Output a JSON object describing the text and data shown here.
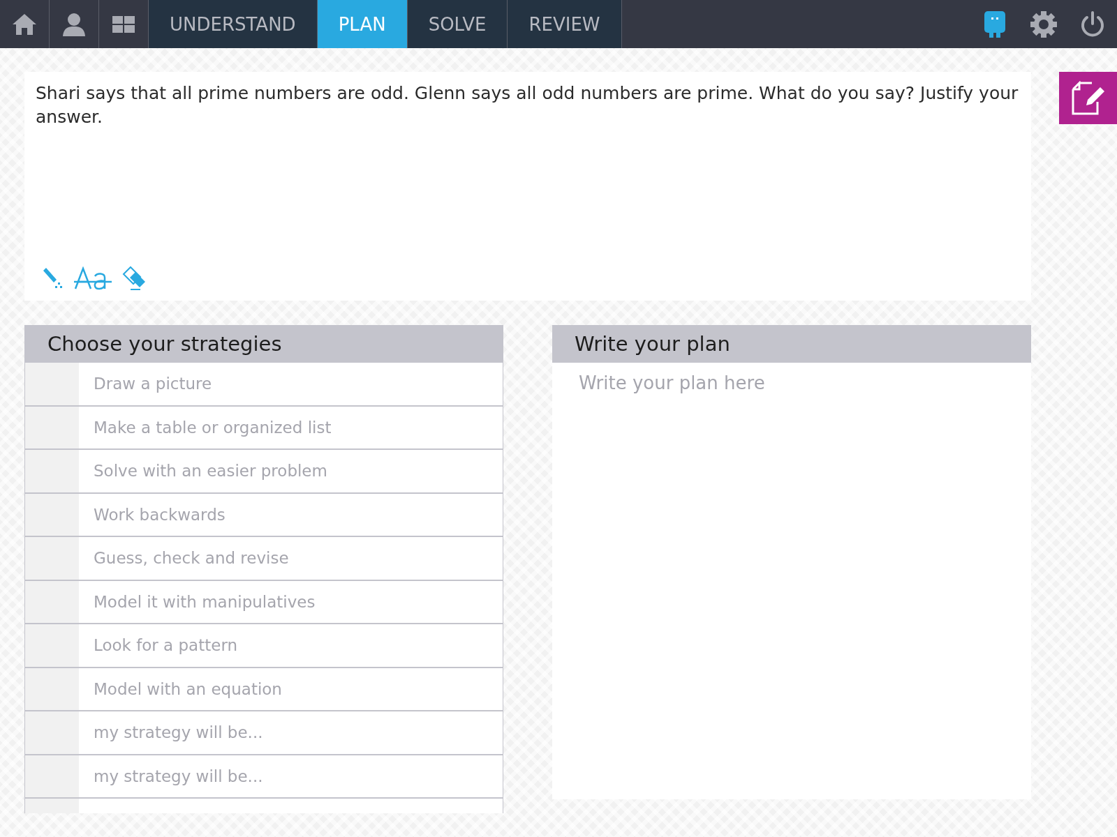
{
  "nav": {
    "tabs": [
      {
        "label": "UNDERSTAND",
        "selected": false
      },
      {
        "label": "PLAN",
        "selected": true
      },
      {
        "label": "SOLVE",
        "selected": false
      },
      {
        "label": "REVIEW",
        "selected": false
      }
    ]
  },
  "question": {
    "text": "Shari says that all prime numbers are odd. Glenn says all odd numbers are prime. What do you say? Justify your answer."
  },
  "strategies": {
    "title": "Choose your strategies",
    "items": [
      {
        "label": "Draw a picture"
      },
      {
        "label": "Make a table or organized list"
      },
      {
        "label": "Solve with an easier problem"
      },
      {
        "label": "Work backwards"
      },
      {
        "label": "Guess, check and revise"
      },
      {
        "label": "Model it with manipulatives"
      },
      {
        "label": "Look for a pattern"
      },
      {
        "label": "Model with an equation"
      },
      {
        "label": "my strategy will be..."
      },
      {
        "label": "my strategy will be..."
      }
    ]
  },
  "plan": {
    "title": "Write your plan",
    "placeholder": "Write your plan here"
  }
}
